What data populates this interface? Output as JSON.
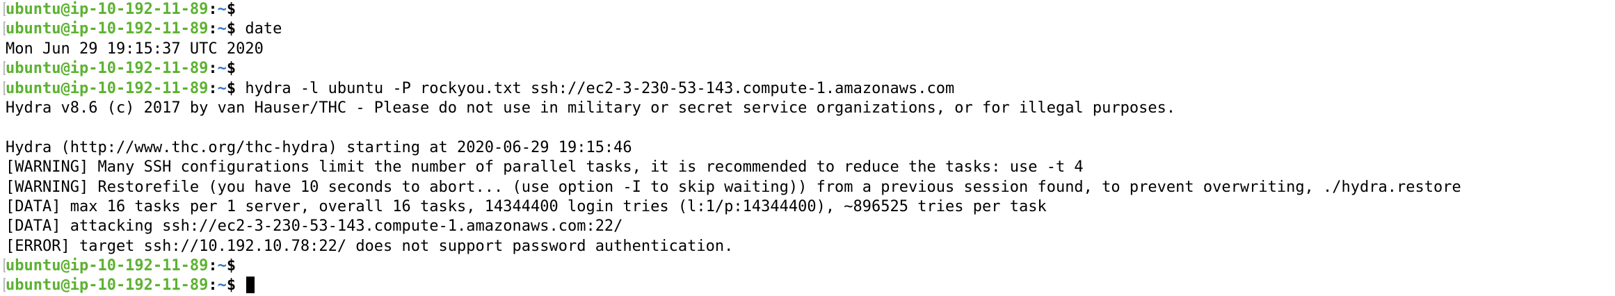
{
  "terminal": {
    "prompt": {
      "user_host": "ubuntu@ip-10-192-11-89",
      "separator": ":",
      "path": "~",
      "symbol": "$"
    },
    "lines": [
      {
        "type": "prompt",
        "command": ""
      },
      {
        "type": "prompt",
        "command": " date"
      },
      {
        "type": "output",
        "text": "Mon Jun 29 19:15:37 UTC 2020"
      },
      {
        "type": "prompt",
        "command": ""
      },
      {
        "type": "prompt",
        "command": " hydra -l ubuntu -P rockyou.txt ssh://ec2-3-230-53-143.compute-1.amazonaws.com"
      },
      {
        "type": "output",
        "text": "Hydra v8.6 (c) 2017 by van Hauser/THC - Please do not use in military or secret service organizations, or for illegal purposes."
      },
      {
        "type": "output",
        "text": ""
      },
      {
        "type": "output",
        "text": "Hydra (http://www.thc.org/thc-hydra) starting at 2020-06-29 19:15:46"
      },
      {
        "type": "output",
        "text": "[WARNING] Many SSH configurations limit the number of parallel tasks, it is recommended to reduce the tasks: use -t 4"
      },
      {
        "type": "output",
        "text": "[WARNING] Restorefile (you have 10 seconds to abort... (use option -I to skip waiting)) from a previous session found, to prevent overwriting, ./hydra.restore"
      },
      {
        "type": "output",
        "text": "[DATA] max 16 tasks per 1 server, overall 16 tasks, 14344400 login tries (l:1/p:14344400), ~896525 tries per task"
      },
      {
        "type": "output",
        "text": "[DATA] attacking ssh://ec2-3-230-53-143.compute-1.amazonaws.com:22/"
      },
      {
        "type": "output",
        "text": "[ERROR] target ssh://10.192.10.78:22/ does not support password authentication."
      },
      {
        "type": "prompt",
        "command": ""
      },
      {
        "type": "prompt",
        "command": " ",
        "cursor": true
      }
    ]
  },
  "colors": {
    "user_host": "#5cb230",
    "path": "#2f71c9",
    "text": "#000000",
    "bracket": "#b9b9b9",
    "background": "#ffffff"
  }
}
